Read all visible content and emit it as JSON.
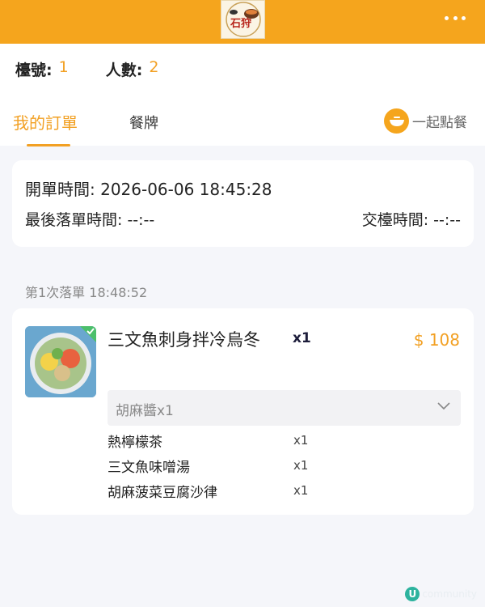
{
  "header": {
    "logo_text": "石狩",
    "more_icon": "more-dots-icon"
  },
  "table_info": {
    "table_label": "檯號:",
    "table_value": "1",
    "people_label": "人數:",
    "people_value": "2"
  },
  "tabs": [
    {
      "label": "我的訂單",
      "active": true
    },
    {
      "label": "餐牌",
      "active": false
    }
  ],
  "together": {
    "label": "一起點餐",
    "icon": "bowl-icon"
  },
  "times": {
    "open": "開單時間: 2026-06-06 18:45:28",
    "last_order": "最後落單時間: --:--",
    "close": "交檯時間: --:--"
  },
  "batch": {
    "label": "第1次落單 18:48:52"
  },
  "order": {
    "main_item": {
      "name": "三文魚刺身拌冷烏冬",
      "qty": "x1",
      "price": "$ 108",
      "option": "胡麻醬x1"
    },
    "sub_items": [
      {
        "name": "熱檸檬茶",
        "qty": "x1"
      },
      {
        "name": "三文魚味噌湯",
        "qty": "x1"
      },
      {
        "name": "胡麻菠菜豆腐沙律",
        "qty": "x1"
      }
    ]
  },
  "watermark": {
    "text": "community"
  },
  "colors": {
    "brand": "#f5a51d",
    "accent_text": "#f2a023"
  }
}
